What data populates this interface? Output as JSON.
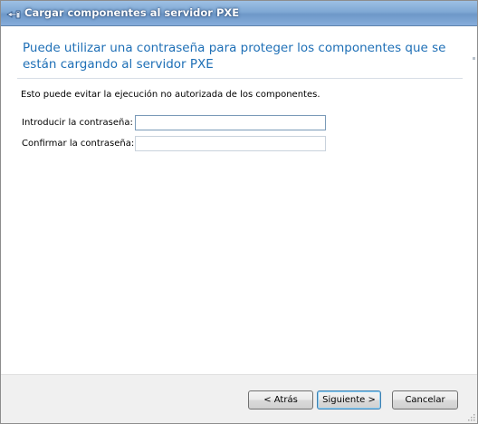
{
  "window": {
    "title": "Cargar componentes al servidor PXE",
    "title_icon": "pxe-server-upload-icon"
  },
  "page": {
    "heading": "Puede utilizar una contraseña para proteger los componentes que se están cargando al servidor PXE",
    "description": "Esto puede evitar la ejecución no autorizada de los componentes."
  },
  "form": {
    "password_label": "Introducir la contraseña:",
    "password_value": "",
    "confirm_label": "Confirmar la contraseña:",
    "confirm_value": ""
  },
  "buttons": {
    "back_label": "< Atrás",
    "next_label": "Siguiente >",
    "cancel_label": "Cancelar"
  },
  "colors": {
    "heading": "#1e6fb6",
    "titlebar": "#7fa8d4",
    "footer": "#f0f0f0"
  }
}
